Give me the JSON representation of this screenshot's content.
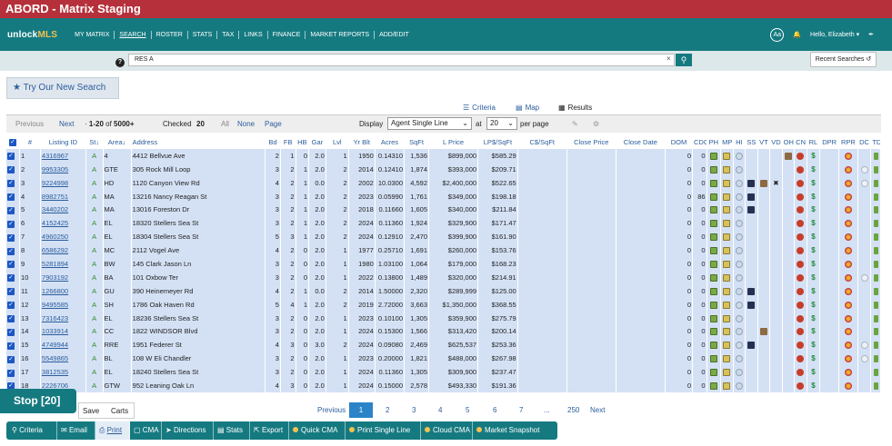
{
  "window": {
    "title": "ABORD - Matrix Staging"
  },
  "nav": {
    "logo_main": "unlock",
    "logo_accent": "MLS",
    "items": [
      "MY MATRIX",
      "SEARCH",
      "ROSTER",
      "STATS",
      "TAX",
      "LINKS",
      "FINANCE",
      "MARKET REPORTS",
      "ADD/EDIT"
    ],
    "active": "SEARCH",
    "aa_label": "Aa",
    "greeting": "Hello, Elizabeth"
  },
  "search": {
    "help": "?",
    "value": "RES A",
    "clear": "×",
    "recent_label": "Recent Searches"
  },
  "try_new_label": "Try Our New Search",
  "view_tabs": {
    "criteria": "Criteria",
    "map": "Map",
    "results": "Results"
  },
  "toolbar": {
    "previous": "Previous",
    "next": "Next",
    "range": "1-20",
    "of_label": "of",
    "total": "5000+",
    "checked_label": "Checked",
    "checked_count": "20",
    "all": "All",
    "none": "None",
    "page": "Page",
    "display_label": "Display",
    "display_value": "Agent Single Line",
    "at_label": "at",
    "per_page_value": "20",
    "per_page_label": "per page"
  },
  "table": {
    "columns": [
      "#",
      "Listing ID",
      "St",
      "Area",
      "Address",
      "Bd",
      "FB",
      "HB",
      "Gar",
      "Lvl",
      "Yr Blt",
      "Acres",
      "SqFt",
      "L Price",
      "LP$/SqFt",
      "C$/SqFt",
      "Close Price",
      "Close Date",
      "DOM",
      "CDOM",
      "PH",
      "MP",
      "HI",
      "SS",
      "VT",
      "VD",
      "OH",
      "CN",
      "RL",
      "DPR",
      "RPR",
      "DC",
      "TD"
    ],
    "rows": [
      [
        "1",
        "4316967",
        "A",
        "4",
        "4412 Bellvue Ave",
        "2",
        "1",
        "0",
        "2.0",
        "1",
        "1950",
        "0.14310",
        "1,536",
        "$899,000",
        "$585.29",
        "",
        "",
        "",
        "0",
        "0"
      ],
      [
        "2",
        "9953305",
        "A",
        "GTE",
        "305 Rock Mill Loop",
        "3",
        "2",
        "1",
        "2.0",
        "2",
        "2014",
        "0.12410",
        "1,874",
        "$393,000",
        "$209.71",
        "",
        "",
        "",
        "0",
        "0"
      ],
      [
        "3",
        "9224998",
        "A",
        "HD",
        "1120 Canyon View Rd",
        "4",
        "2",
        "1",
        "0.0",
        "2",
        "2002",
        "10.0300",
        "4,592",
        "$2,400,000",
        "$522.65",
        "",
        "",
        "",
        "0",
        "0"
      ],
      [
        "4",
        "8982751",
        "A",
        "MA",
        "13216 Nancy Reagan St",
        "3",
        "2",
        "1",
        "2.0",
        "2",
        "2023",
        "0.05990",
        "1,761",
        "$349,000",
        "$198.18",
        "",
        "",
        "",
        "0",
        "86"
      ],
      [
        "5",
        "3440202",
        "A",
        "MA",
        "13016 Foreston Dr",
        "3",
        "2",
        "1",
        "2.0",
        "2",
        "2018",
        "0.11660",
        "1,605",
        "$340,000",
        "$211.84",
        "",
        "",
        "",
        "0",
        "0"
      ],
      [
        "6",
        "4152425",
        "A",
        "EL",
        "18320 Stellers Sea St",
        "3",
        "2",
        "1",
        "2.0",
        "2",
        "2024",
        "0.11360",
        "1,924",
        "$329,900",
        "$171.47",
        "",
        "",
        "",
        "0",
        "0"
      ],
      [
        "7",
        "4960250",
        "A",
        "EL",
        "18304 Stellers Sea St",
        "5",
        "3",
        "1",
        "2.0",
        "2",
        "2024",
        "0.12910",
        "2,470",
        "$399,900",
        "$161.90",
        "",
        "",
        "",
        "0",
        "0"
      ],
      [
        "8",
        "6586292",
        "A",
        "MC",
        "2112 Vogel Ave",
        "4",
        "2",
        "0",
        "2.0",
        "1",
        "1977",
        "0.25710",
        "1,691",
        "$260,000",
        "$153.76",
        "",
        "",
        "",
        "0",
        "0"
      ],
      [
        "9",
        "5281894",
        "A",
        "BW",
        "145 Clark Jason Ln",
        "3",
        "2",
        "0",
        "2.0",
        "1",
        "1980",
        "1.03100",
        "1,064",
        "$179,000",
        "$168.23",
        "",
        "",
        "",
        "0",
        "0"
      ],
      [
        "10",
        "7903192",
        "A",
        "BA",
        "101 Oxbow Ter",
        "3",
        "2",
        "0",
        "2.0",
        "1",
        "2022",
        "0.13800",
        "1,489",
        "$320,000",
        "$214.91",
        "",
        "",
        "",
        "0",
        "0"
      ],
      [
        "11",
        "1266800",
        "A",
        "GU",
        "390 Heinemeyer Rd",
        "4",
        "2",
        "1",
        "0.0",
        "2",
        "2014",
        "1.50000",
        "2,320",
        "$289,999",
        "$125.00",
        "",
        "",
        "",
        "0",
        "0"
      ],
      [
        "12",
        "9495585",
        "A",
        "SH",
        "1786 Oak Haven Rd",
        "5",
        "4",
        "1",
        "2.0",
        "2",
        "2019",
        "2.72000",
        "3,663",
        "$1,350,000",
        "$368.55",
        "",
        "",
        "",
        "0",
        "0"
      ],
      [
        "13",
        "7316423",
        "A",
        "EL",
        "18236 Stellers Sea St",
        "3",
        "2",
        "0",
        "2.0",
        "1",
        "2023",
        "0.10100",
        "1,305",
        "$359,900",
        "$275.79",
        "",
        "",
        "",
        "0",
        "0"
      ],
      [
        "14",
        "1033914",
        "A",
        "CC",
        "1822 WINDSOR Blvd",
        "3",
        "2",
        "0",
        "2.0",
        "1",
        "2024",
        "0.15300",
        "1,566",
        "$313,420",
        "$200.14",
        "",
        "",
        "",
        "0",
        "0"
      ],
      [
        "15",
        "4749944",
        "A",
        "RRE",
        "1951 Federer St",
        "4",
        "3",
        "0",
        "3.0",
        "2",
        "2024",
        "0.09080",
        "2,469",
        "$625,537",
        "$253.36",
        "",
        "",
        "",
        "0",
        "0"
      ],
      [
        "16",
        "5549865",
        "A",
        "BL",
        "108 W Eli Chandler",
        "3",
        "2",
        "0",
        "2.0",
        "1",
        "2023",
        "0.20000",
        "1,821",
        "$488,000",
        "$267.98",
        "",
        "",
        "",
        "0",
        "0"
      ],
      [
        "17",
        "3812535",
        "A",
        "EL",
        "18240 Stellers Sea St",
        "3",
        "2",
        "0",
        "2.0",
        "1",
        "2024",
        "0.11360",
        "1,305",
        "$309,900",
        "$237.47",
        "",
        "",
        "",
        "0",
        "0"
      ],
      [
        "18",
        "2226706",
        "A",
        "GTW",
        "952 Leaning Oak Ln",
        "4",
        "3",
        "0",
        "2.0",
        "1",
        "2024",
        "0.15000",
        "2,578",
        "$493,330",
        "$191.36",
        "",
        "",
        "",
        "0",
        "0"
      ]
    ]
  },
  "stop_label": "Stop [20]",
  "save_label": "Save",
  "carts_label": "Carts",
  "pagination": {
    "previous": "Previous",
    "pages": [
      "1",
      "2",
      "3",
      "4",
      "5",
      "6",
      "7"
    ],
    "ellipsis": "...",
    "last": "250",
    "next": "Next",
    "current": "1"
  },
  "actions": [
    "Criteria",
    "Email",
    "Print",
    "CMA",
    "Directions",
    "Stats",
    "Export",
    "Quick CMA",
    "Print Single Line",
    "Cloud CMA",
    "Market Snapshot"
  ],
  "colors": {
    "header_red": "#b5303a",
    "nav_teal": "#157a80",
    "row_blue": "#d4e1f5",
    "link_blue": "#2a5d9c"
  }
}
